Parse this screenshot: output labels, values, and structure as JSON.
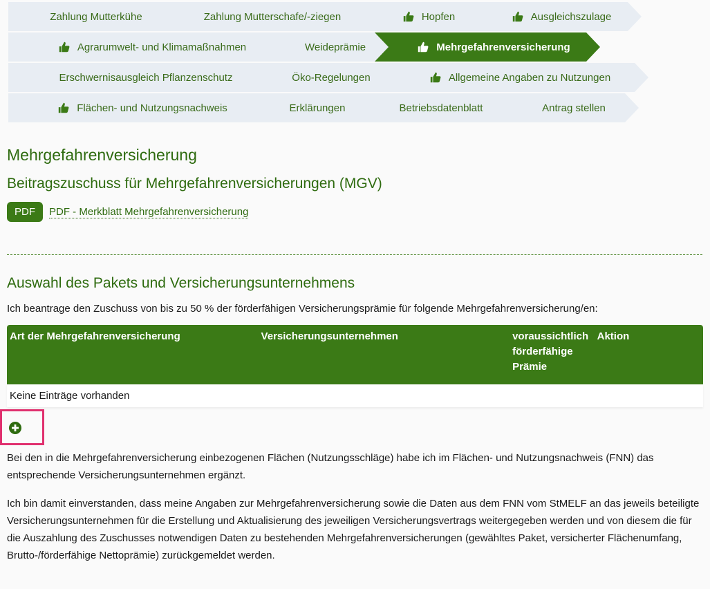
{
  "wizard": {
    "rows": [
      [
        {
          "label": "Zahlung Mutterkühe",
          "done": false,
          "active": false
        },
        {
          "label": "Zahlung Mutterschafe/-ziegen",
          "done": false,
          "active": false
        },
        {
          "label": "Hopfen",
          "done": true,
          "active": false
        },
        {
          "label": "Ausgleichszulage",
          "done": true,
          "active": false
        }
      ],
      [
        {
          "label": "Agrarumwelt- und Klimamaßnahmen",
          "done": true,
          "active": false
        },
        {
          "label": "Weideprämie",
          "done": false,
          "active": false
        },
        {
          "label": "Mehrgefahrenversicherung",
          "done": true,
          "active": true
        }
      ],
      [
        {
          "label": "Erschwernisausgleich Pflanzenschutz",
          "done": false,
          "active": false
        },
        {
          "label": "Öko-Regelungen",
          "done": false,
          "active": false
        },
        {
          "label": "Allgemeine Angaben zu Nutzungen",
          "done": true,
          "active": false
        }
      ],
      [
        {
          "label": "Flächen- und Nutzungsnachweis",
          "done": true,
          "active": false
        },
        {
          "label": "Erklärungen",
          "done": false,
          "active": false
        },
        {
          "label": "Betriebsdatenblatt",
          "done": false,
          "active": false
        },
        {
          "label": "Antrag stellen",
          "done": false,
          "active": false
        }
      ]
    ]
  },
  "page": {
    "title": "Mehrgefahrenversicherung",
    "subtitle": "Beitragszuschuss für Mehrgefahrenversicherungen (MGV)",
    "pdf_badge": "PDF",
    "pdf_link": "PDF - Merkblatt Mehrgefahrenversicherung"
  },
  "section": {
    "title": "Auswahl des Pakets und Versicherungsunternehmens",
    "intro": "Ich beantrage den Zuschuss von bis zu 50 % der förderfähigen Versicherungsprämie für folgende Mehrgefahrenversicherung/en:"
  },
  "table": {
    "col1": "Art der Mehrgefahrenversicherung",
    "col2": "Versicherungsunternehmen",
    "col3": "voraussichtlich förderfähige Prämie",
    "col4": "Aktion",
    "empty": "Keine Einträge vorhanden"
  },
  "texts": {
    "p1": "Bei den in die Mehrgefahrenversicherung einbezogenen Flächen (Nutzungsschläge) habe ich im Flächen- und Nutzungsnachweis (FNN) das entsprechende Versicherungsunternehmen ergänzt.",
    "p2": "Ich bin damit einverstanden, dass meine Angaben zur Mehrgefahrenversicherung sowie die Daten aus dem FNN vom StMELF an das jeweils beteiligte Versicherungsunternehmen für die Erstellung und Aktualisierung des jeweiligen Versicherungsvertrags weitergegeben werden und von diesem die für die Auszahlung des Zuschusses notwendigen Daten zu bestehenden Mehrgefahrenversicherungen (gewähltes Paket, versicherter Flächenumfang, Brutto-/förderfähige Nettoprämie) zurückgemeldet werden."
  },
  "colors": {
    "accent": "#3b7a16",
    "chevron_bg": "#e8edf3",
    "highlight": "#e0306e"
  },
  "icons": {
    "done": "thumbs-up-icon",
    "add": "plus-circle-icon"
  }
}
